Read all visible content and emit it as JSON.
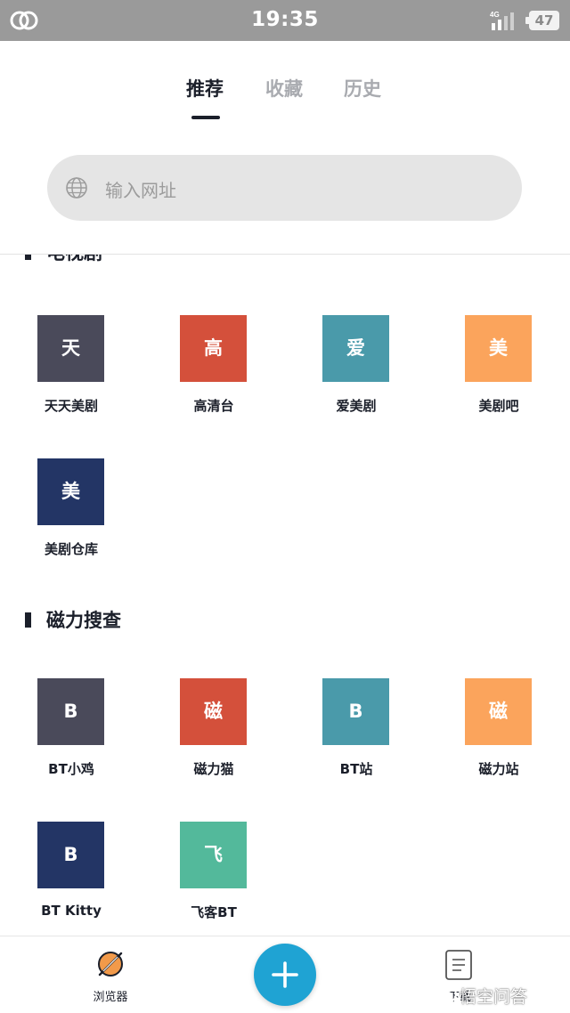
{
  "status_bar": {
    "time": "19:35",
    "network": "4G",
    "battery": "47"
  },
  "tabs": [
    {
      "label": "推荐",
      "active": true
    },
    {
      "label": "收藏",
      "active": false
    },
    {
      "label": "历史",
      "active": false
    }
  ],
  "search": {
    "placeholder": "输入网址",
    "icon": "globe-icon"
  },
  "sections": [
    {
      "title": "电视剧",
      "sites": [
        {
          "glyph": "天",
          "label": "天天美剧",
          "color": "#4a4a5a"
        },
        {
          "glyph": "高",
          "label": "高清台",
          "color": "#d4503b"
        },
        {
          "glyph": "爱",
          "label": "爱美剧",
          "color": "#4a9aaa"
        },
        {
          "glyph": "美",
          "label": "美剧吧",
          "color": "#fba45c"
        },
        {
          "glyph": "美",
          "label": "美剧仓库",
          "color": "#233565"
        }
      ]
    },
    {
      "title": "磁力搜查",
      "sites": [
        {
          "glyph": "B",
          "label": "BT小鸡",
          "color": "#4a4a5a"
        },
        {
          "glyph": "磁",
          "label": "磁力猫",
          "color": "#d4503b"
        },
        {
          "glyph": "B",
          "label": "BT站",
          "color": "#4a9aaa"
        },
        {
          "glyph": "磁",
          "label": "磁力站",
          "color": "#fba45c"
        },
        {
          "glyph": "B",
          "label": "BT Kitty",
          "color": "#233565"
        },
        {
          "glyph": "飞",
          "label": "飞客BT",
          "color": "#53b99b"
        }
      ]
    }
  ],
  "bottom_nav": {
    "browser_label": "浏览器",
    "download_label": "下载",
    "add_icon": "plus-icon",
    "accent": "#1fa3d3"
  },
  "watermark": "悟空问答"
}
